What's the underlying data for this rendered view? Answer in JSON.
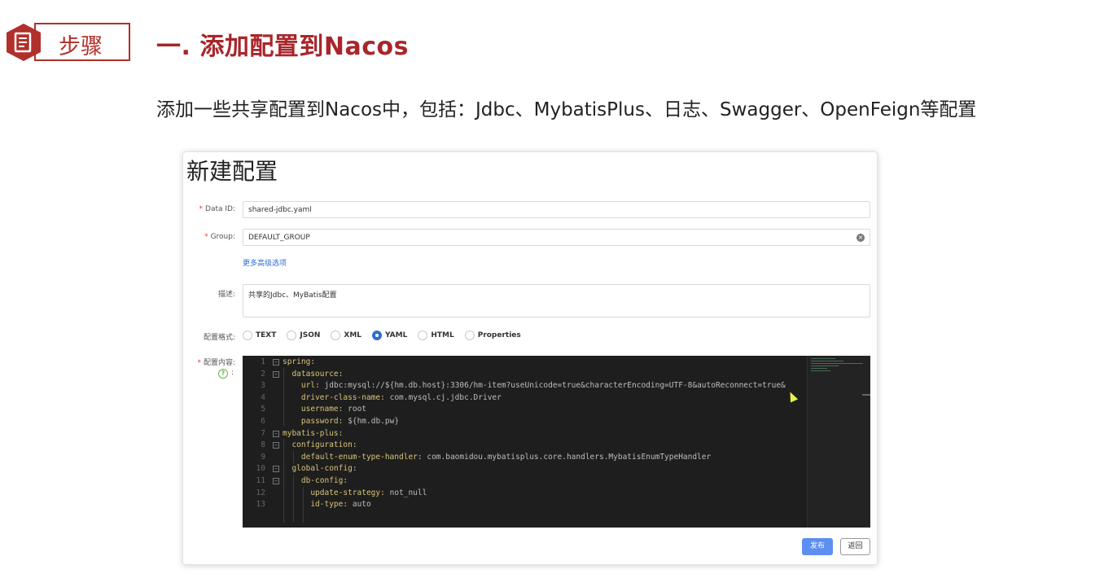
{
  "slide": {
    "badge_label": "步骤",
    "title": "一. 添加配置到Nacos",
    "subtitle": "添加一些共享配置到Nacos中，包括：Jdbc、MybatisPlus、日志、Swagger、OpenFeign等配置"
  },
  "dialog": {
    "title": "新建配置",
    "data_id": {
      "label": "Data ID:",
      "value": "shared-jdbc.yaml"
    },
    "group": {
      "label": "Group:",
      "value": "DEFAULT_GROUP"
    },
    "advanced_link": "更多高级选项",
    "description": {
      "label": "描述:",
      "value": "共享的Jdbc、MyBatis配置"
    },
    "format": {
      "label": "配置格式:",
      "options": [
        "TEXT",
        "JSON",
        "XML",
        "YAML",
        "HTML",
        "Properties"
      ],
      "selected": "YAML"
    },
    "content": {
      "label": "配置内容:",
      "help_colon": ":",
      "lines": [
        {
          "n": "1",
          "fold": true,
          "indent": "",
          "key": "spring",
          "value": ""
        },
        {
          "n": "2",
          "fold": true,
          "indent": "  ",
          "key": "datasource",
          "value": ""
        },
        {
          "n": "3",
          "fold": false,
          "indent": "    ",
          "key": "url",
          "value": "jdbc:mysql://${hm.db.host}:3306/hm-item?useUnicode=true&characterEncoding=UTF-8&autoReconnect=true&"
        },
        {
          "n": "4",
          "fold": false,
          "indent": "    ",
          "key": "driver-class-name",
          "value": "com.mysql.cj.jdbc.Driver"
        },
        {
          "n": "5",
          "fold": false,
          "indent": "    ",
          "key": "username",
          "value": "root"
        },
        {
          "n": "6",
          "fold": false,
          "indent": "    ",
          "key": "password",
          "value": "${hm.db.pw}"
        },
        {
          "n": "7",
          "fold": true,
          "indent": "",
          "key": "mybatis-plus",
          "value": ""
        },
        {
          "n": "8",
          "fold": true,
          "indent": "  ",
          "key": "configuration",
          "value": ""
        },
        {
          "n": "9",
          "fold": false,
          "indent": "    ",
          "key": "default-enum-type-handler",
          "value": "com.baomidou.mybatisplus.core.handlers.MybatisEnumTypeHandler"
        },
        {
          "n": "10",
          "fold": true,
          "indent": "  ",
          "key": "global-config",
          "value": ""
        },
        {
          "n": "11",
          "fold": true,
          "indent": "    ",
          "key": "db-config",
          "value": ""
        },
        {
          "n": "12",
          "fold": false,
          "indent": "      ",
          "key": "update-strategy",
          "value": "not_null"
        },
        {
          "n": "13",
          "fold": false,
          "indent": "      ",
          "key": "id-type",
          "value": "auto"
        }
      ]
    },
    "publish_button": "发布",
    "back_button": "返回"
  },
  "colors": {
    "brand_red": "#a8262b",
    "primary_blue": "#5d8ef0",
    "editor_bg": "#1e1e1e"
  }
}
